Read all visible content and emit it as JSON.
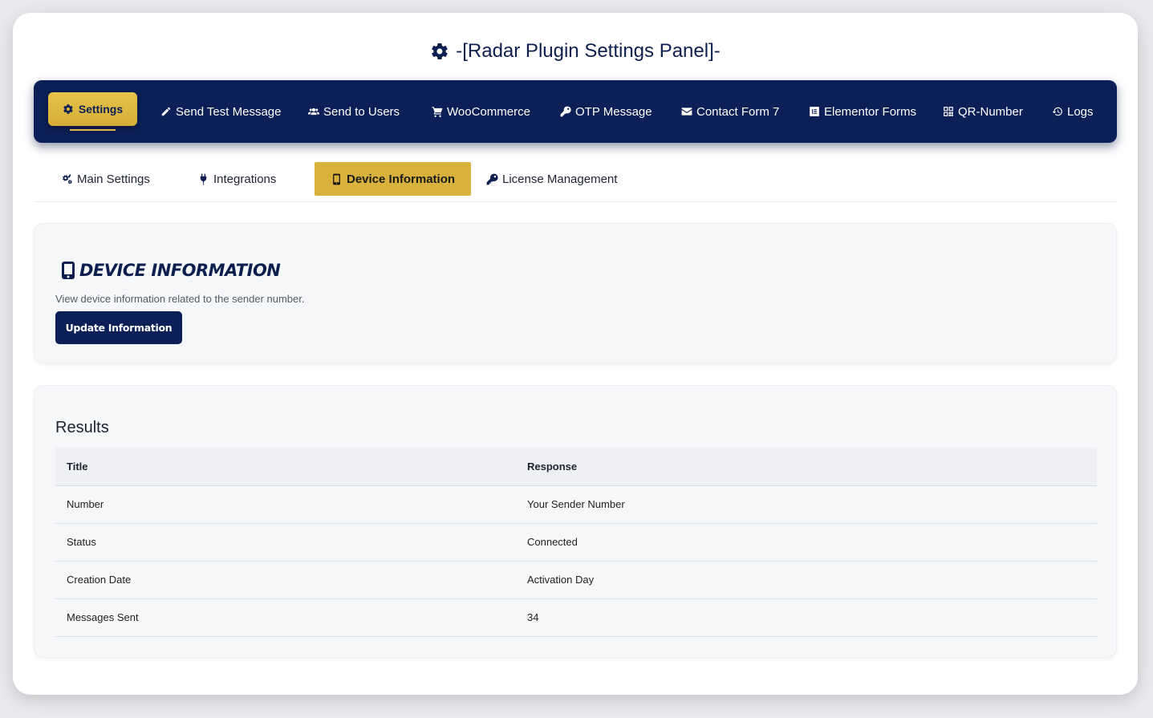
{
  "header": {
    "title": "-[Radar Plugin Settings Panel]-",
    "icon": "gear-icon"
  },
  "colors": {
    "navy": "#0c1f57",
    "gold": "#d9b23d",
    "card_bg": "#f6f7f9"
  },
  "topnav": {
    "items": [
      {
        "label": "Settings",
        "icon": "gear-icon",
        "active": true
      },
      {
        "label": "Send Test Message",
        "icon": "pencil-icon"
      },
      {
        "label": "Send to Users",
        "icon": "users-icon"
      },
      {
        "label": "WooCommerce",
        "icon": "cart-icon"
      },
      {
        "label": "OTP Message",
        "icon": "key-icon"
      },
      {
        "label": "Contact Form 7",
        "icon": "envelope-icon"
      },
      {
        "label": "Elementor Forms",
        "icon": "elementor-icon"
      },
      {
        "label": "QR-Number",
        "icon": "qrcode-icon"
      },
      {
        "label": "Logs",
        "icon": "history-icon"
      }
    ]
  },
  "subtabs": {
    "items": [
      {
        "label": "Main Settings",
        "icon": "gears-icon"
      },
      {
        "label": "Integrations",
        "icon": "plug-icon"
      },
      {
        "label": "Device Information",
        "icon": "mobile-icon",
        "active": true
      },
      {
        "label": "License Management",
        "icon": "key-icon"
      }
    ]
  },
  "device": {
    "title": "Device Information",
    "description": "View device information related to the sender number.",
    "button_label": "Update Information"
  },
  "results": {
    "title": "Results",
    "columns": [
      "Title",
      "Response"
    ],
    "rows": [
      [
        "Number",
        "Your Sender Number"
      ],
      [
        "Status",
        "Connected"
      ],
      [
        "Creation Date",
        "Activation Day"
      ],
      [
        "Messages Sent",
        "34"
      ]
    ]
  }
}
